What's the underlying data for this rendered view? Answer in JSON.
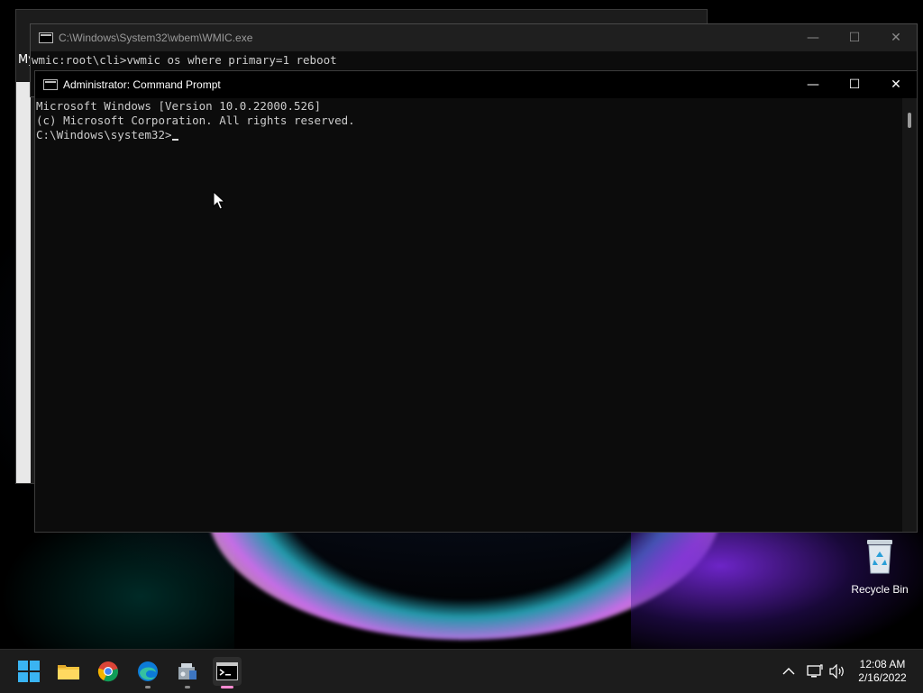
{
  "back_window": {
    "partial_label": "My"
  },
  "wmic_window": {
    "title": "C:\\Windows\\System32\\wbem\\WMIC.exe",
    "lines": [
      "wmic:root\\cli>vwmic os where primary=1 reboot"
    ]
  },
  "admin_window": {
    "title": "Administrator: Command Prompt",
    "lines": [
      "Microsoft Windows [Version 10.0.22000.526]",
      "(c) Microsoft Corporation. All rights reserved.",
      "",
      "C:\\Windows\\system32>"
    ]
  },
  "window_controls": {
    "minimize": "—",
    "maximize": "☐",
    "close": "✕"
  },
  "desktop": {
    "recycle_bin_label": "Recycle Bin"
  },
  "taskbar": {
    "apps": [
      {
        "icon": "windows-start-icon"
      },
      {
        "icon": "file-explorer-icon"
      },
      {
        "icon": "chrome-icon"
      },
      {
        "icon": "edge-icon"
      },
      {
        "icon": "hardware-app-icon"
      },
      {
        "icon": "command-prompt-icon"
      }
    ],
    "tray": {
      "overflow": "^",
      "time": "12:08 AM",
      "date": "2/16/2022"
    }
  },
  "colors": {
    "accent_pink": "#ff8bd1",
    "console_text": "#cccccc",
    "console_bg": "#0c0c0c"
  }
}
